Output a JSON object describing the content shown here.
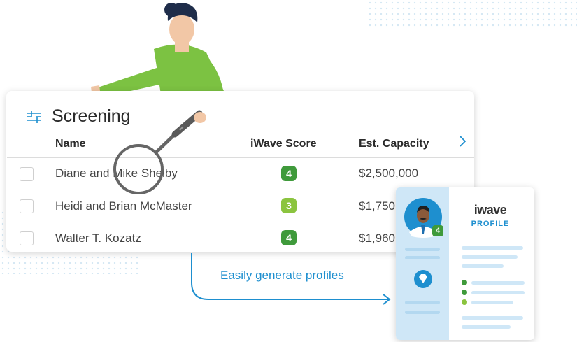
{
  "screening": {
    "title": "Screening",
    "columns": [
      "Name",
      "iWave Score",
      "Est. Capacity"
    ],
    "rows": [
      {
        "name": "Diane and Mike Shelby",
        "score": "4",
        "capacity": "$2,500,000"
      },
      {
        "name": "Heidi and Brian McMaster",
        "score": "3",
        "capacity": "$1,750"
      },
      {
        "name": "Walter T. Kozatz",
        "score": "4",
        "capacity": "$1,960"
      }
    ]
  },
  "callout": {
    "text": "Easily generate profiles"
  },
  "profile_card": {
    "brand": "iwave",
    "title": "PROFILE",
    "avatar_score": "4"
  },
  "colors": {
    "score_dark": "#3f9a3b",
    "score_light": "#8bc43f",
    "accent": "#1e8fcf",
    "shirt": "#7cc242"
  },
  "icons": [
    "sliders-icon",
    "chevron-right-icon",
    "magnifier-icon",
    "diamond-icon",
    "avatar-icon"
  ]
}
